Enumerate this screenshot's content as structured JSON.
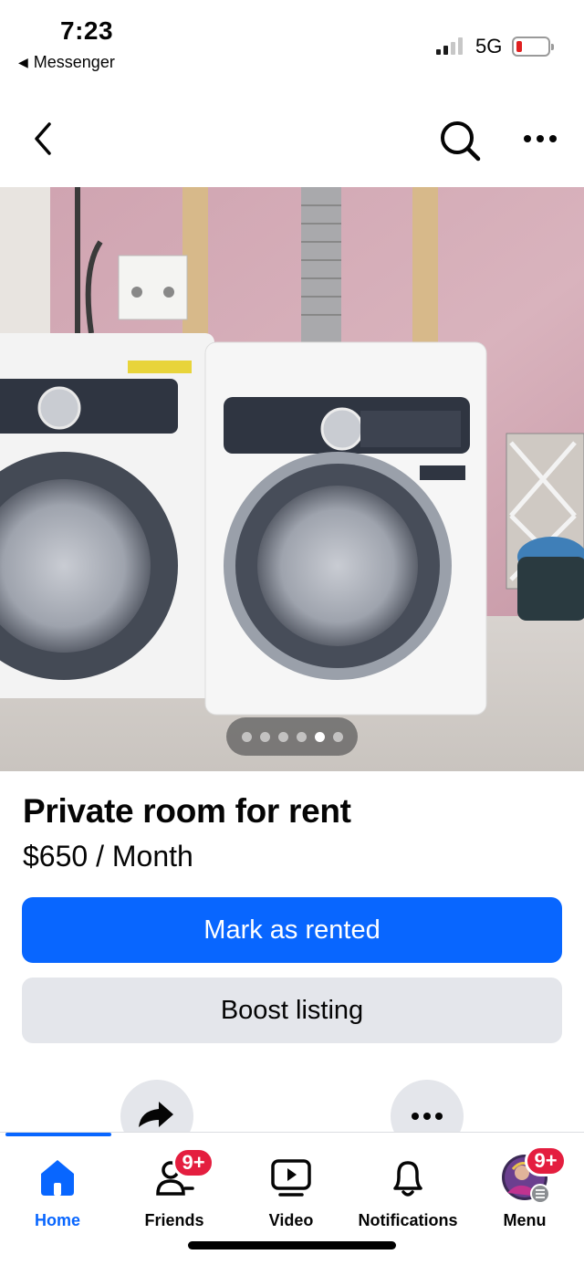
{
  "status_bar": {
    "time": "7:23",
    "back_app": "Messenger",
    "network": "5G"
  },
  "nav": {
    "back_icon": "chevron-left-icon",
    "search_icon": "search-icon",
    "more_icon": "more-horizontal-icon"
  },
  "photo": {
    "description_icon": "listing-photo",
    "carousel": {
      "total": 6,
      "current_index": 5
    }
  },
  "listing": {
    "title": "Private room for rent",
    "price": "$650 / Month"
  },
  "actions": {
    "mark_rented_label": "Mark as rented",
    "boost_label": "Boost listing",
    "share_icon": "share-icon",
    "more_icon": "more-horizontal-icon"
  },
  "tabs": [
    {
      "label": "Home",
      "icon": "home-icon",
      "active": true
    },
    {
      "label": "Friends",
      "icon": "friends-icon",
      "badge": "9+"
    },
    {
      "label": "Video",
      "icon": "video-icon"
    },
    {
      "label": "Notifications",
      "icon": "bell-icon"
    },
    {
      "label": "Menu",
      "icon": "avatar-menu-icon",
      "badge": "9+"
    }
  ],
  "colors": {
    "primary": "#0866ff",
    "secondary_button": "#e4e6eb",
    "badge": "#e41e3f"
  }
}
